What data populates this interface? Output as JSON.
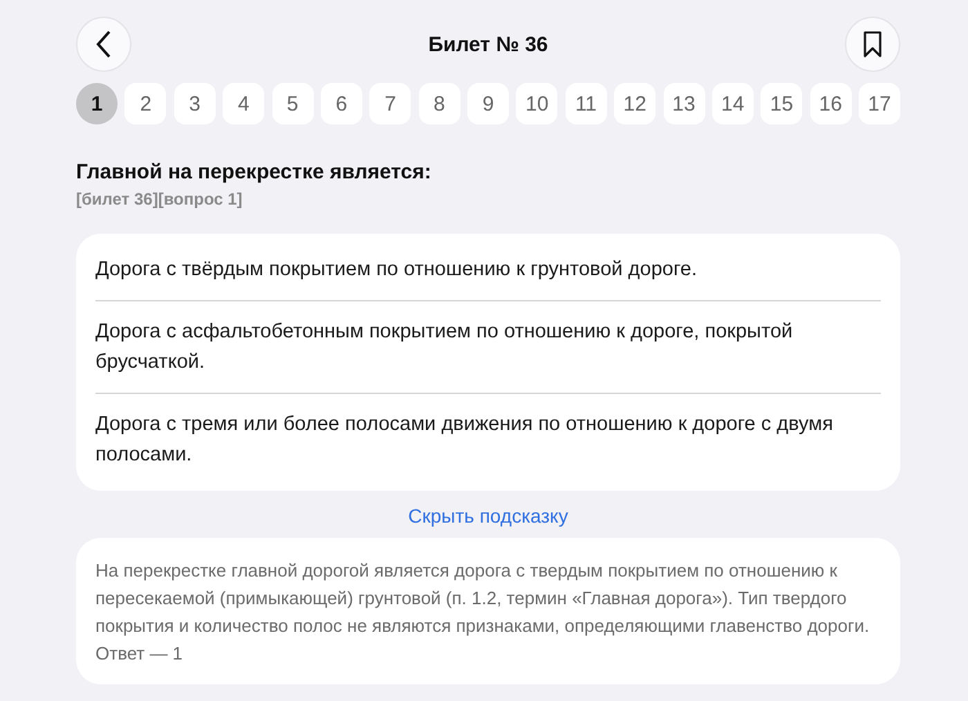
{
  "header": {
    "title": "Билет № 36"
  },
  "questions": [
    {
      "label": "1",
      "selected": true
    },
    {
      "label": "2",
      "selected": false
    },
    {
      "label": "3",
      "selected": false
    },
    {
      "label": "4",
      "selected": false
    },
    {
      "label": "5",
      "selected": false
    },
    {
      "label": "6",
      "selected": false
    },
    {
      "label": "7",
      "selected": false
    },
    {
      "label": "8",
      "selected": false
    },
    {
      "label": "9",
      "selected": false
    },
    {
      "label": "10",
      "selected": false
    },
    {
      "label": "11",
      "selected": false
    },
    {
      "label": "12",
      "selected": false
    },
    {
      "label": "13",
      "selected": false
    },
    {
      "label": "14",
      "selected": false
    },
    {
      "label": "15",
      "selected": false
    },
    {
      "label": "16",
      "selected": false
    },
    {
      "label": "17",
      "selected": false
    }
  ],
  "question": {
    "text": "Главной на перекрестке является:",
    "tag": "[билет 36][вопрос 1]"
  },
  "answers": [
    "Дорога с твёрдым покрытием по отношению к грунтовой дороге.",
    "Дорога с асфальтобетонным покрытием по отношению к дороге, покрытой брусчаткой.",
    "Дорога с тремя или более полосами движения по отношению к дороге с двумя полосами."
  ],
  "hint": {
    "toggle": "Скрыть подсказку",
    "text": "На перекрестке главной дорогой является дорога с твердым покрытием по отношению к пересекаемой (примыкающей) грунтовой (п. 1.2, термин «Главная дорога»). Тип твердого покрытия и количество полос не являются признаками, определяющими главенство дороги. Ответ — 1"
  }
}
